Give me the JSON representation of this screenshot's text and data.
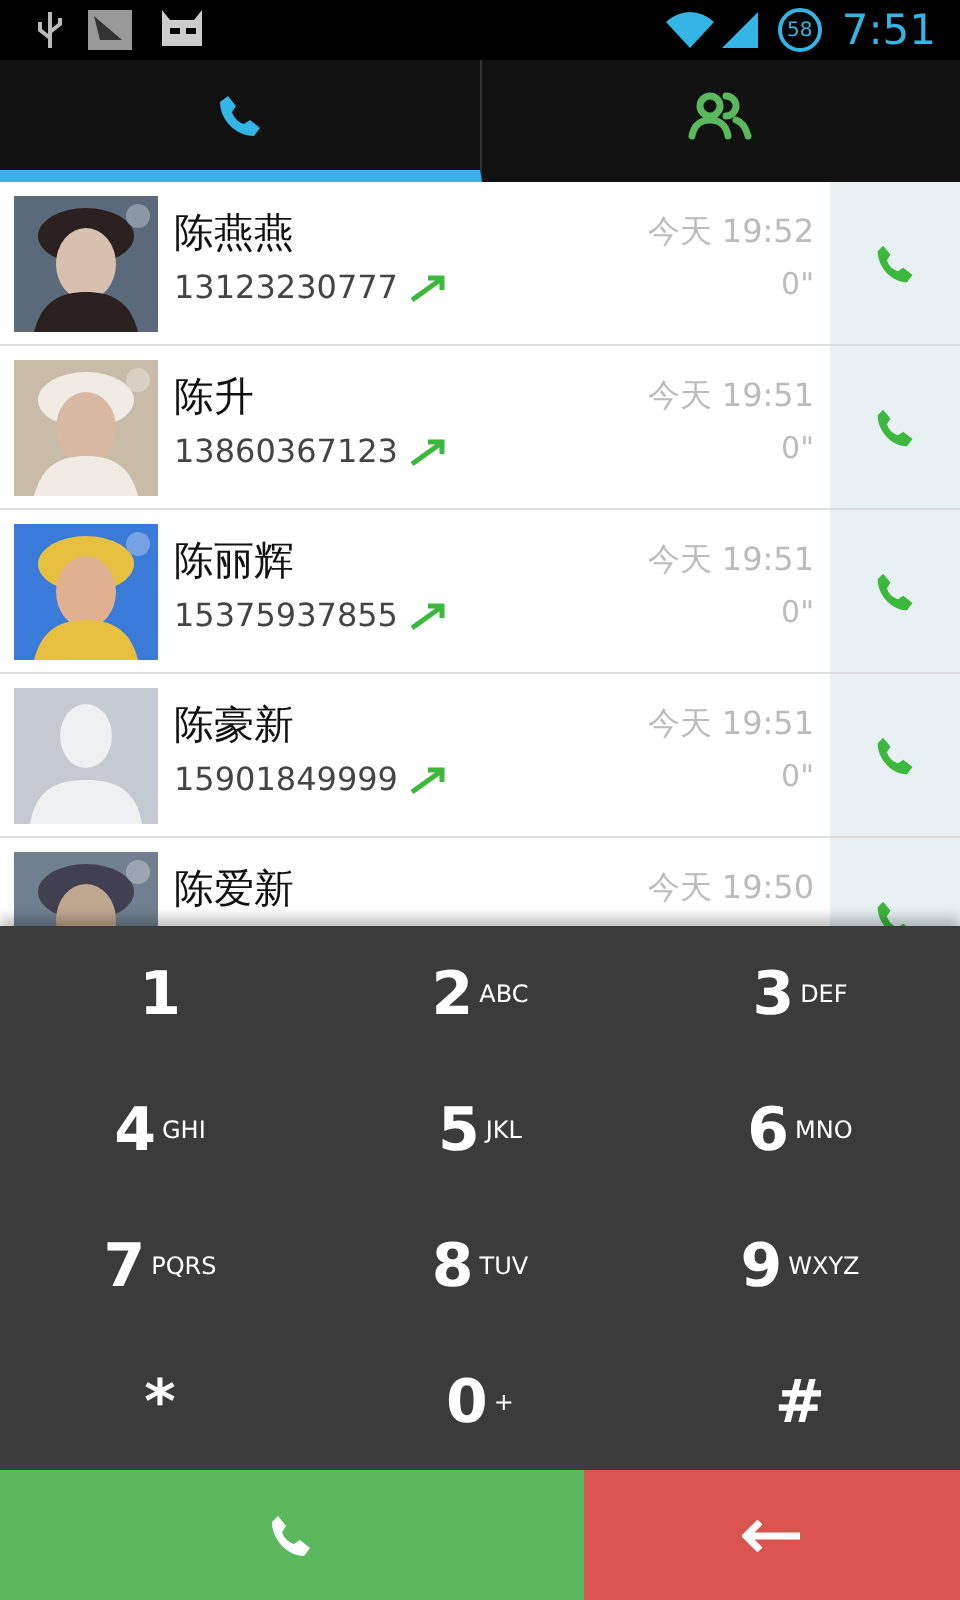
{
  "status_bar": {
    "battery": "58",
    "time": "7:51"
  },
  "tabs": [
    {
      "kind": "calls",
      "selected": true
    },
    {
      "kind": "contacts",
      "selected": false
    }
  ],
  "call_log": [
    {
      "kind": "picture",
      "name": "陈燕燕",
      "number": "13123230777",
      "outgoing": true,
      "time": "今天 19:52",
      "duration": "0\""
    },
    {
      "kind": "picture",
      "name": "陈升",
      "number": "13860367123",
      "outgoing": true,
      "time": "今天 19:51",
      "duration": "0\""
    },
    {
      "kind": "picture",
      "name": "陈丽辉",
      "number": "15375937855",
      "outgoing": true,
      "time": "今天 19:51",
      "duration": "0\""
    },
    {
      "kind": "default",
      "name": "陈豪新",
      "number": "15901849999",
      "outgoing": true,
      "time": "今天 19:51",
      "duration": "0\""
    },
    {
      "kind": "picture",
      "name": "陈爱新",
      "time": "今天 19:50"
    }
  ],
  "dialpad": [
    {
      "digit": "1"
    },
    {
      "digit": "2",
      "letters": "ABC"
    },
    {
      "digit": "3",
      "letters": "DEF"
    },
    {
      "digit": "4",
      "letters": "GHI"
    },
    {
      "digit": "5",
      "letters": "JKL"
    },
    {
      "digit": "6",
      "letters": "MNO"
    },
    {
      "digit": "7",
      "letters": "PQRS"
    },
    {
      "digit": "8",
      "letters": "TUV"
    },
    {
      "digit": "9",
      "letters": "WXYZ"
    },
    {
      "digit": "*"
    },
    {
      "digit": "0",
      "letters": "+"
    },
    {
      "digit": "#"
    }
  ]
}
